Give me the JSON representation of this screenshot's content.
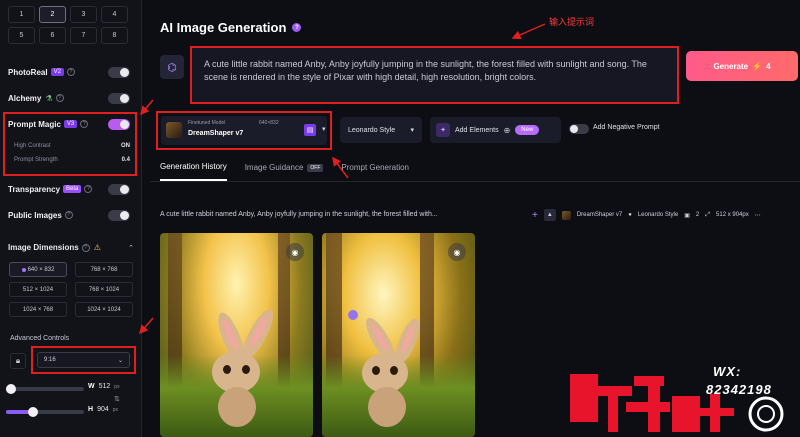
{
  "sidebar": {
    "image_counts": [
      "1",
      "2",
      "3",
      "4",
      "5",
      "6",
      "7",
      "8"
    ],
    "photoreal": {
      "label": "PhotoReal",
      "badge": "V2"
    },
    "alchemy": {
      "label": "Alchemy"
    },
    "prompt_magic": {
      "label": "Prompt Magic",
      "badge": "V3",
      "high_contrast_label": "High Contrast",
      "high_contrast_value": "ON",
      "strength_label": "Prompt Strength",
      "strength_value": "0.4"
    },
    "transparency": {
      "label": "Transparency",
      "badge": "Beta"
    },
    "public_images": {
      "label": "Public Images"
    },
    "image_dimensions": {
      "label": "Image Dimensions",
      "options": [
        "640 × 832",
        "768 × 768",
        "512 × 1024",
        "768 × 1024",
        "1024 × 768",
        "1024 × 1024"
      ]
    },
    "advanced_controls": {
      "label": "Advanced Controls",
      "aspect_ratio": "9:16"
    },
    "width": {
      "key": "W",
      "value": "512",
      "unit": "px",
      "fill": 0.02
    },
    "height": {
      "key": "H",
      "value": "904",
      "unit": "px",
      "fill": 0.35
    }
  },
  "main": {
    "title": "AI Image Generation",
    "annotation": "输入提示词",
    "prompt": "A cute little rabbit named Anby, Anby joyfully jumping in the sunlight, the forest filled with sunlight and song. The scene is rendered in the style of Pixar with high detail, high resolution, bright colors.",
    "generate": {
      "label": "Generate",
      "cost": "4"
    },
    "model": {
      "sub": "Finetuned Model",
      "size": "640×832",
      "name": "DreamShaper v7"
    },
    "style": {
      "label": "Leonardo Style"
    },
    "add_elements": {
      "label": "Add Elements",
      "badge": "New"
    },
    "negative": {
      "label": "Add Negative Prompt"
    },
    "tabs": [
      {
        "label": "Generation History"
      },
      {
        "label": "Image Guidance",
        "badge": "OFF"
      },
      {
        "label": "Prompt Generation"
      }
    ],
    "history": {
      "prompt": "A cute little rabbit named Anby, Anby joyfully jumping in the sunlight, the forest filled with...",
      "model": "DreamShaper v7",
      "style": "Leonardo Style",
      "count": "2",
      "size": "512 x 904px"
    }
  },
  "watermark": {
    "wx": "WX:",
    "number": "82342198",
    "text": "蜗牛教授",
    "small": "Dr.Snail"
  },
  "colors": {
    "accent": "#b85bf0",
    "annotation_red": "#e02020",
    "generate_start": "#ff5a8a",
    "generate_end": "#ff6a6a"
  }
}
